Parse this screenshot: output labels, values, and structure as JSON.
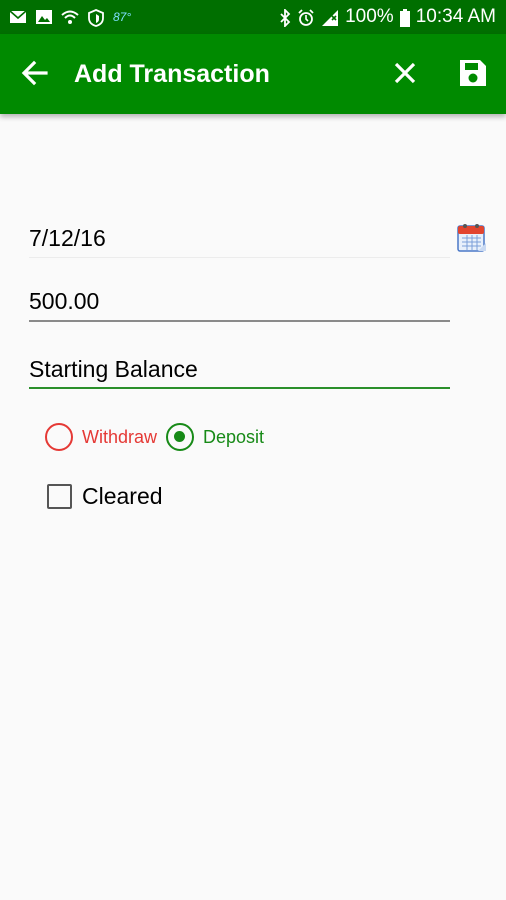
{
  "status_bar": {
    "temperature": "87°",
    "battery_percent": "100%",
    "time": "10:34 AM",
    "icons": [
      "email-icon",
      "gallery-icon",
      "wifi-icon",
      "shield-icon",
      "bluetooth-icon",
      "alarm-icon",
      "signal-icon",
      "battery-icon"
    ]
  },
  "app_bar": {
    "title": "Add Transaction",
    "icons": [
      "back-arrow-icon",
      "close-icon",
      "save-icon"
    ]
  },
  "form": {
    "date": "7/12/16",
    "amount": "500.00",
    "description": "Starting Balance",
    "type_options": [
      {
        "label": "Withdraw",
        "selected": false,
        "color": "#e53935"
      },
      {
        "label": "Deposit",
        "selected": true,
        "color": "#178a17"
      }
    ],
    "cleared_label": "Cleared",
    "cleared_checked": false,
    "calendar_icon": "calendar-icon"
  },
  "colors": {
    "status_bar": "#006f00",
    "app_bar": "#008a00",
    "accent": "#2a8f2a",
    "withdraw": "#e53935",
    "deposit": "#178a17"
  }
}
